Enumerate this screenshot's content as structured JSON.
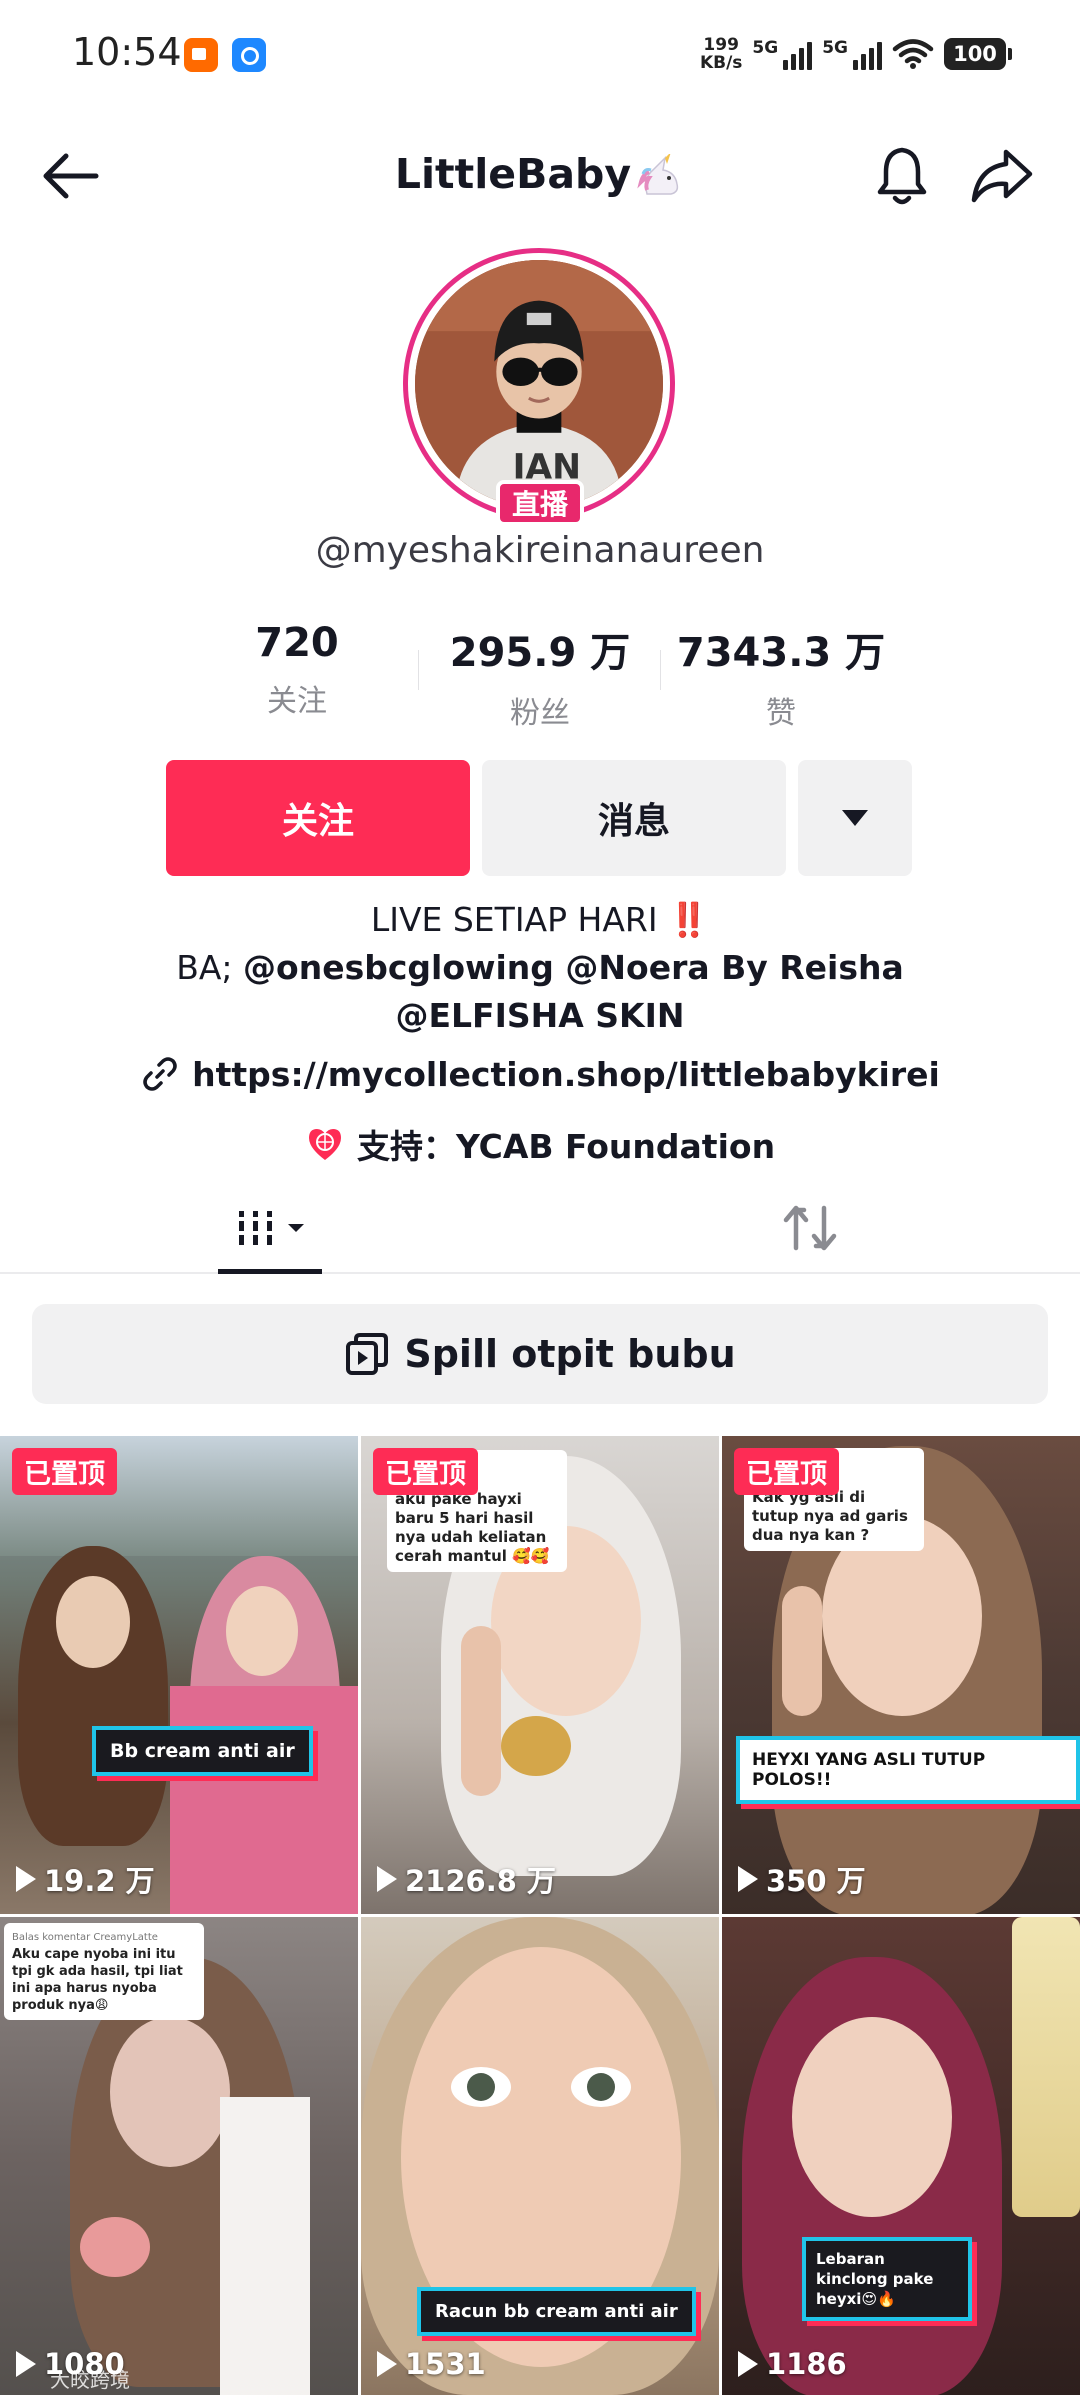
{
  "status_bar": {
    "time": "10:54",
    "net_speed_value": "199",
    "net_speed_unit": "KB/s",
    "sim1": "5G",
    "sim2": "5G",
    "battery": "100"
  },
  "header": {
    "title": "LittleBaby"
  },
  "profile": {
    "live_badge": "直播",
    "username": "@myeshakireinanaureen",
    "stats": [
      {
        "value": "720",
        "label": "关注"
      },
      {
        "value": "295.9 万",
        "label": "粉丝"
      },
      {
        "value": "7343.3 万",
        "label": "赞"
      }
    ],
    "follow_label": "关注",
    "message_label": "消息",
    "bio_line1": "LIVE SETIAP HARI",
    "bio_line1_emoji": "‼️",
    "bio_prefix": "BA; ",
    "bio_mentions": "@onesbcglowing @Noera By Reisha @ELFISHA SKIN",
    "link": "https://mycollection.shop/littlebabykirei",
    "support": "支持：YCAB Foundation"
  },
  "playlist": {
    "label": "Spill otpit bubu"
  },
  "videos": [
    {
      "pinned": "已置顶",
      "views": "19.2 万",
      "overlay": "Bb cream anti air"
    },
    {
      "pinned": "已置顶",
      "views": "2126.8 万",
      "overlay": "aku pake hayxi baru 5 hari hasil nya udah keliatan cerah mantul 🥰🥰"
    },
    {
      "pinned": "已置顶",
      "views": "350 万",
      "overlay": "HEYXI YANG ASLI TUTUP POLOS!!",
      "comment": "Kak yg asli di tutup nya ad garis dua nya kan ?"
    },
    {
      "views": "1080",
      "overlay": "Aku cape nyoba ini itu tpi gk ada hasil, tpi liat ini apa harus nyoba produk nya😩",
      "comment_header": "Balas komentar CreamyLatte"
    },
    {
      "views": "1531",
      "overlay": "Racun bb cream anti air"
    },
    {
      "views": "1186",
      "overlay": "Lebaran kinclong pake heyxi😍🔥"
    }
  ],
  "watermark": "大皎跨境",
  "colors": {
    "accent": "#fe2c55",
    "live_ring": "#e62e85",
    "secondary_button": "#f1f1f2"
  }
}
